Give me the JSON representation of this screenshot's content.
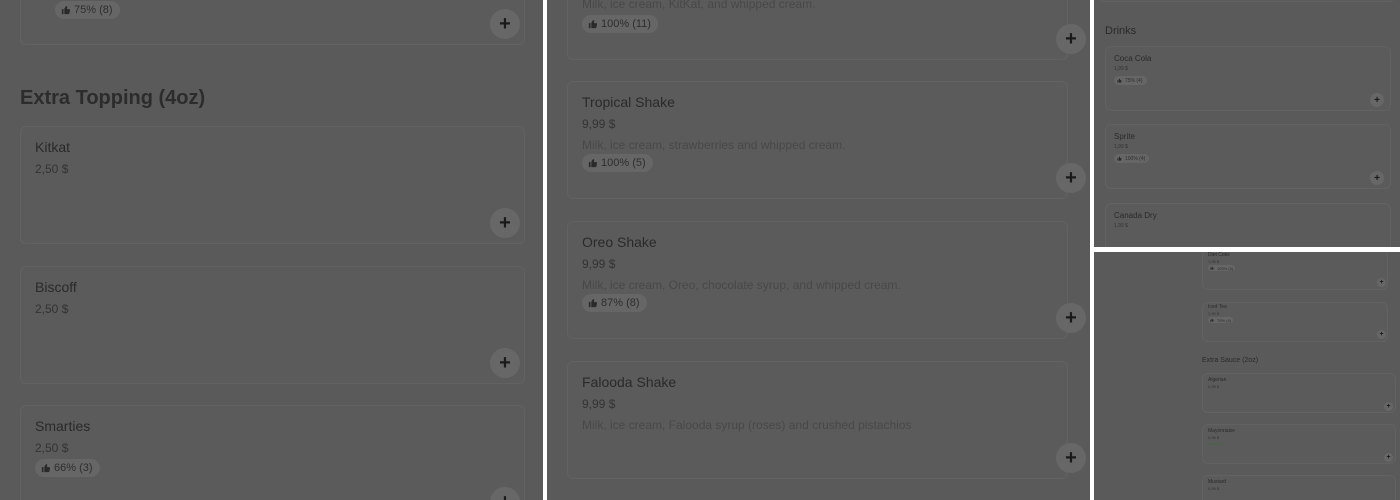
{
  "panel1": {
    "top_card": {
      "rating": "75% (8)"
    },
    "section_title": "Extra Topping (4oz)",
    "items": [
      {
        "name": "Kitkat",
        "price": "2,50 $"
      },
      {
        "name": "Biscoff",
        "price": "2,50 $"
      },
      {
        "name": "Smarties",
        "price": "2,50 $",
        "rating": "66% (3)"
      }
    ]
  },
  "panel2": {
    "top_card": {
      "desc": "Milk, ice cream, KitKat, and whipped cream.",
      "rating": "100% (11)"
    },
    "items": [
      {
        "name": "Tropical Shake",
        "price": "9,99 $",
        "desc": "Milk, ice cream, strawberries and whipped cream.",
        "rating": "100% (5)"
      },
      {
        "name": "Oreo Shake",
        "price": "9,99 $",
        "desc": "Milk, ice cream, Oreo, chocolate syrup, and whipped cream.",
        "rating": "87% (8)"
      },
      {
        "name": "Falooda Shake",
        "price": "9,99 $",
        "desc": "Milk, ice cream, Falooda syrup (roses) and crushed pistachios"
      }
    ]
  },
  "panel3": {
    "section_title": "Drinks",
    "items": [
      {
        "name": "Coca Cola",
        "price": "1,99 $",
        "rating": "75% (4)"
      },
      {
        "name": "Sprite",
        "price": "1,99 $",
        "rating": "100% (4)"
      },
      {
        "name": "Canada Dry",
        "price": "1,99 $"
      }
    ]
  },
  "panel4": {
    "section_title": "Extra Sauce (2oz)",
    "items": [
      {
        "name": "Diet Coke",
        "price": "1,99 $",
        "rating": "100% (3)"
      },
      {
        "name": "Iced Tea",
        "price": "1,99 $",
        "rating": "75% (4)"
      },
      {
        "name": "Algerian",
        "price": "0,99 $"
      },
      {
        "name": "Mayonnaise",
        "price": "0,99 $",
        "sub": "Popular"
      },
      {
        "name": "Mustard",
        "price": "0,99 $"
      }
    ]
  },
  "icons": {
    "add": "plus-icon",
    "rating": "thumbs-up-icon"
  },
  "add_symbol": "+",
  "colors": {
    "overlay": "#5a5a5a",
    "background": "#ffffff"
  }
}
